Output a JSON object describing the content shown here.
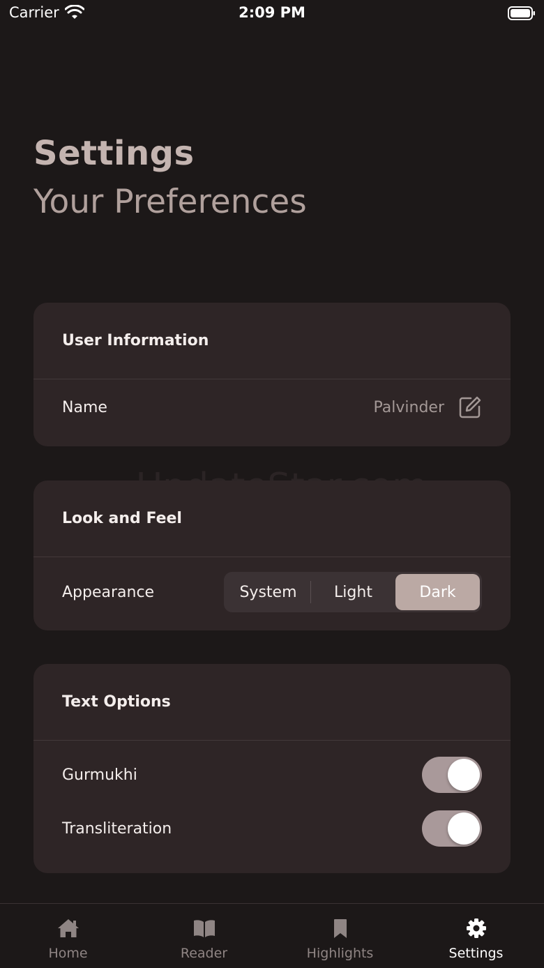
{
  "status_bar": {
    "carrier": "Carrier",
    "time": "2:09 PM"
  },
  "header": {
    "title": "Settings",
    "subtitle": "Your Preferences"
  },
  "watermark": "UpdateStar.com",
  "sections": {
    "user_info": {
      "title": "User Information",
      "name_label": "Name",
      "name_value": "Palvinder"
    },
    "look_feel": {
      "title": "Look and Feel",
      "appearance_label": "Appearance",
      "options": [
        "System",
        "Light",
        "Dark"
      ],
      "selected": "Dark"
    },
    "text_options": {
      "title": "Text Options",
      "gurmukhi_label": "Gurmukhi",
      "gurmukhi_on": true,
      "transliteration_label": "Transliteration",
      "transliteration_on": true
    }
  },
  "tab_bar": {
    "tabs": [
      {
        "label": "Home",
        "icon": "home-icon"
      },
      {
        "label": "Reader",
        "icon": "book-icon"
      },
      {
        "label": "Highlights",
        "icon": "bookmark-icon"
      },
      {
        "label": "Settings",
        "icon": "gear-icon"
      }
    ],
    "active": "Settings"
  },
  "colors": {
    "background": "#1c1818",
    "card": "#2e2526",
    "accent": "#bba9a4",
    "title": "#c4b4b0"
  }
}
